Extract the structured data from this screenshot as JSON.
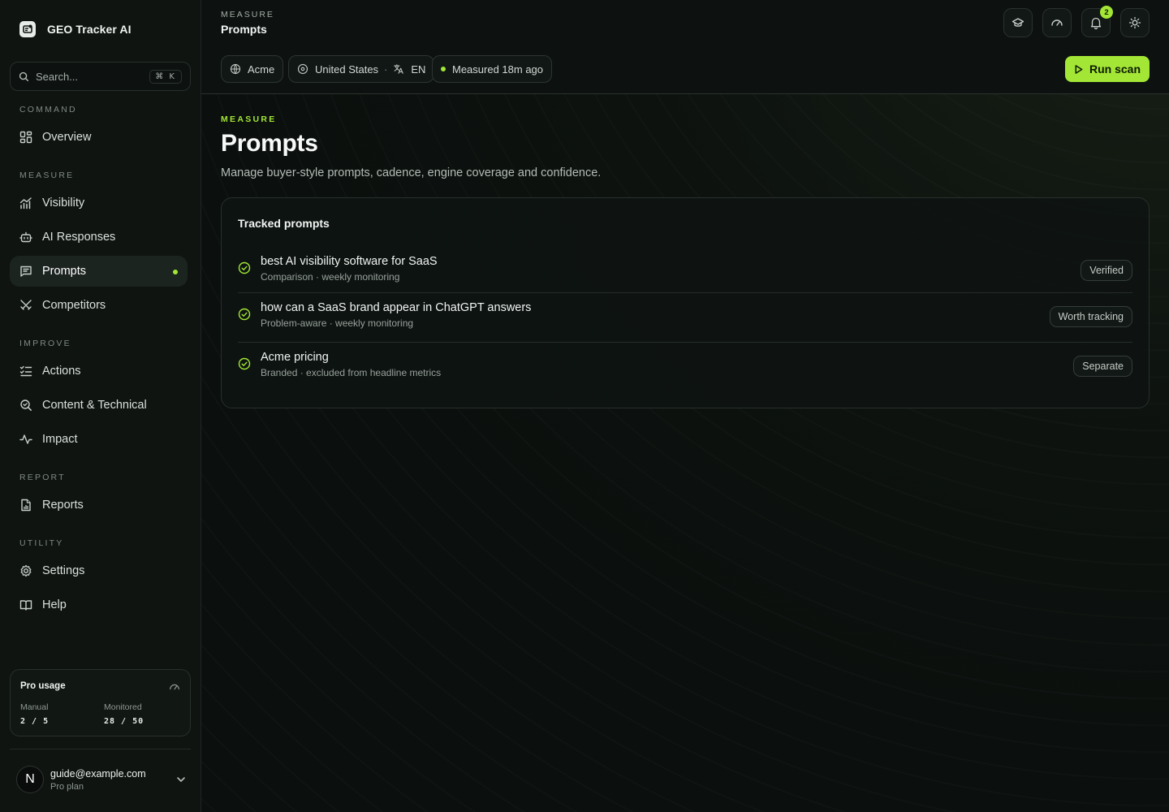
{
  "app": {
    "name": "GEO Tracker AI"
  },
  "search": {
    "placeholder": "Search...",
    "shortcut": "⌘ K"
  },
  "sidebar": {
    "sections": [
      {
        "label": "COMMAND",
        "items": [
          {
            "label": "Overview",
            "icon": "grid-icon"
          }
        ]
      },
      {
        "label": "MEASURE",
        "items": [
          {
            "label": "Visibility",
            "icon": "bar-chart-icon"
          },
          {
            "label": "AI Responses",
            "icon": "bot-icon"
          },
          {
            "label": "Prompts",
            "icon": "message-square-icon",
            "active": true
          },
          {
            "label": "Competitors",
            "icon": "swords-icon"
          }
        ]
      },
      {
        "label": "IMPROVE",
        "items": [
          {
            "label": "Actions",
            "icon": "list-checks-icon"
          },
          {
            "label": "Content & Technical",
            "icon": "search-check-icon"
          },
          {
            "label": "Impact",
            "icon": "activity-icon"
          }
        ]
      },
      {
        "label": "REPORT",
        "items": [
          {
            "label": "Reports",
            "icon": "file-chart-icon"
          }
        ]
      },
      {
        "label": "UTILITY",
        "items": [
          {
            "label": "Settings",
            "icon": "gear-icon"
          },
          {
            "label": "Help",
            "icon": "book-icon"
          }
        ]
      }
    ]
  },
  "usage": {
    "title": "Pro usage",
    "manual_label": "Manual",
    "manual_value": "2 / 5",
    "monitored_label": "Monitored",
    "monitored_value": "28 / 50"
  },
  "account": {
    "initial": "N",
    "email": "guide@example.com",
    "plan": "Pro plan"
  },
  "header": {
    "section": "MEASURE",
    "title": "Prompts",
    "notifications_count": "2",
    "brand_chip": "Acme",
    "country": "United States",
    "language": "EN",
    "measured": "Measured 18m ago",
    "run_label": "Run scan"
  },
  "page": {
    "eyebrow": "MEASURE",
    "title": "Prompts",
    "subtitle": "Manage buyer-style prompts, cadence, engine coverage and confidence."
  },
  "card": {
    "title": "Tracked prompts",
    "rows": [
      {
        "title": "best AI visibility software for SaaS",
        "meta": "Comparison · weekly monitoring",
        "status": "Verified"
      },
      {
        "title": "how can a SaaS brand appear in ChatGPT answers",
        "meta": "Problem-aware · weekly monitoring",
        "status": "Worth tracking"
      },
      {
        "title": "Acme pricing",
        "meta": "Branded · excluded from headline metrics",
        "status": "Separate"
      }
    ]
  },
  "colors": {
    "accent": "#a3e635",
    "background": "#0b0f0d",
    "sidebar": "#0f1411"
  }
}
